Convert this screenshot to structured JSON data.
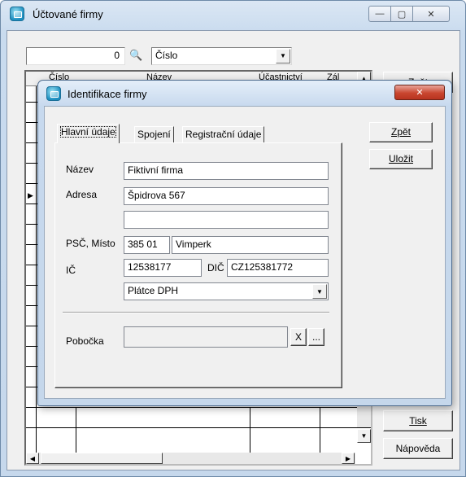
{
  "outer_window": {
    "title": "Účtované firmy",
    "caption_buttons": {
      "minimize": "—",
      "maximize": "▢",
      "close": "✕"
    },
    "toolbar": {
      "number_value": "0",
      "search_field_selected": "Číslo"
    },
    "grid_headers": [
      "Číslo",
      "Název",
      "Účastnictví",
      "Zál"
    ],
    "side_buttons": {
      "zpet": "Zpět",
      "tisk": "Tisk",
      "napoveda": "Nápověda"
    }
  },
  "dialog": {
    "title": "Identifikace firmy",
    "tabs": [
      "Hlavní údaje",
      "Spojení",
      "Registrační údaje"
    ],
    "fields": {
      "nazev": {
        "label": "Název",
        "value": "Fiktivní firma"
      },
      "adresa": {
        "label": "Adresa",
        "value": "Špidrova 567",
        "value2": ""
      },
      "psc_misto": {
        "label": "PSČ, Místo",
        "psc": "385 01",
        "misto": "Vimperk"
      },
      "ic": {
        "label": "IČ",
        "value": "12538177"
      },
      "dic": {
        "label": "DIČ",
        "value": "CZ125381772"
      },
      "dph": {
        "value": "Plátce DPH"
      },
      "pobocka": {
        "label": "Pobočka",
        "value": ""
      }
    },
    "buttons": {
      "zpet": "Zpět",
      "ulozit": "Uložit",
      "clear": "X",
      "browse": "..."
    }
  }
}
